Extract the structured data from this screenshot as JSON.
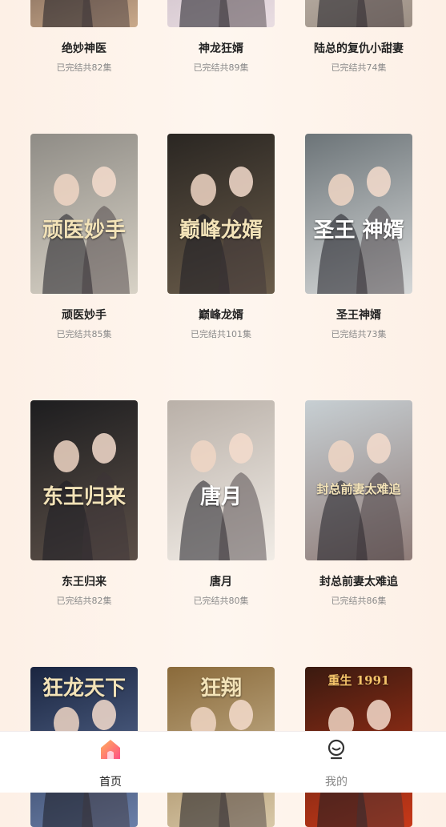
{
  "dramas": [
    {
      "title": "绝妙神医",
      "status": "已完结共82集",
      "art_text": "",
      "colors": [
        "#3a2a2a",
        "#c9a98a"
      ]
    },
    {
      "title": "神龙狂婿",
      "status": "已完结共89集",
      "art_text": "",
      "colors": [
        "#b8a8b4",
        "#e9dde2"
      ]
    },
    {
      "title": "陆总的复仇小甜妻",
      "status": "已完结共74集",
      "art_text": "",
      "colors": [
        "#d9d1c8",
        "#9c8f84"
      ]
    },
    {
      "title": "顽医妙手",
      "status": "已完结共85集",
      "art_text": "顽医妙手",
      "colors": [
        "#8f8c86",
        "#d8d2c6"
      ]
    },
    {
      "title": "巅峰龙婿",
      "status": "已完结共101集",
      "art_text": "巅峰龙婿",
      "colors": [
        "#2a2622",
        "#6a5c4a"
      ]
    },
    {
      "title": "圣王神婿",
      "status": "已完结共73集",
      "art_text": "圣王 神婿",
      "colors": [
        "#6c7478",
        "#d6d8d8"
      ]
    },
    {
      "title": "东王归来",
      "status": "已完结共82集",
      "art_text": "东王归来",
      "colors": [
        "#1d1d1f",
        "#5c5048"
      ]
    },
    {
      "title": "唐月",
      "status": "已完结共80集",
      "art_text": "唐月",
      "colors": [
        "#b9b0a8",
        "#f1ece6"
      ]
    },
    {
      "title": "封总前妻太难追",
      "status": "已完结共86集",
      "art_text": "封总前妻太难追",
      "colors": [
        "#c7cfd3",
        "#8f7c78"
      ]
    },
    {
      "title": "",
      "status": "",
      "art_text": "狂龙天下",
      "colors": [
        "#1a2540",
        "#6a7fa8"
      ]
    },
    {
      "title": "",
      "status": "",
      "art_text": "狂翔",
      "colors": [
        "#8a6a3a",
        "#d8c8a8"
      ]
    },
    {
      "title": "",
      "status": "",
      "art_text": "重生 1991",
      "colors": [
        "#3a1a10",
        "#c83818"
      ]
    }
  ],
  "tabbar": {
    "home_label": "首页",
    "mine_label": "我的",
    "home_color": "#222222",
    "mine_color": "#888888",
    "accent": "#ff6a8a"
  }
}
